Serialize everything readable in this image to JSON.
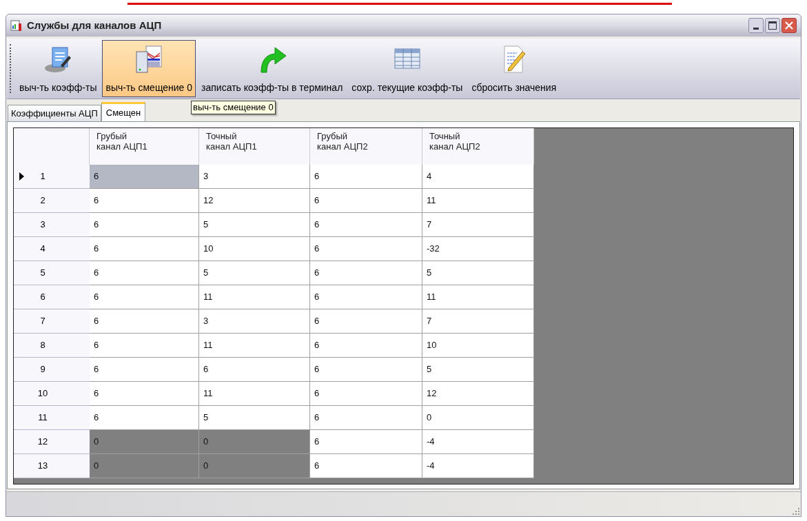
{
  "window": {
    "title": "Службы для каналов АЦП"
  },
  "toolbar": [
    {
      "label": "выч-ть коэфф-ты",
      "kind": "calc",
      "hovered": false
    },
    {
      "label": "выч-ть смещение 0",
      "kind": "offset",
      "hovered": true
    },
    {
      "label": "записать коэфф-ты в терминал",
      "kind": "write",
      "hovered": false
    },
    {
      "label": "сохр. текущие коэфф-ты",
      "kind": "save",
      "hovered": false
    },
    {
      "label": "сбросить значения",
      "kind": "reset",
      "hovered": false
    }
  ],
  "tooltip": "выч-ть смещение 0",
  "tabs": [
    {
      "label": "Коэффициенты АЦП",
      "selected": false
    },
    {
      "label": "Смещен",
      "selected": true
    }
  ],
  "table": {
    "columns": [
      "Грубый\nканал АЦП1",
      "Точный\nканал АЦП1",
      "Грубый\nканал АЦП2",
      "Точный\nканал АЦП2"
    ],
    "rows": [
      {
        "number": "1",
        "current": true,
        "cells": [
          {
            "value": "6",
            "selected": true,
            "disabled": false
          },
          {
            "value": "3",
            "selected": false,
            "disabled": false
          },
          {
            "value": "6",
            "selected": false,
            "disabled": false
          },
          {
            "value": "4",
            "selected": false,
            "disabled": false
          }
        ]
      },
      {
        "number": "2",
        "current": false,
        "cells": [
          {
            "value": "6",
            "selected": false,
            "disabled": false
          },
          {
            "value": "12",
            "selected": false,
            "disabled": false
          },
          {
            "value": "6",
            "selected": false,
            "disabled": false
          },
          {
            "value": "11",
            "selected": false,
            "disabled": false
          }
        ]
      },
      {
        "number": "3",
        "current": false,
        "cells": [
          {
            "value": "6",
            "selected": false,
            "disabled": false
          },
          {
            "value": "5",
            "selected": false,
            "disabled": false
          },
          {
            "value": "6",
            "selected": false,
            "disabled": false
          },
          {
            "value": "7",
            "selected": false,
            "disabled": false
          }
        ]
      },
      {
        "number": "4",
        "current": false,
        "cells": [
          {
            "value": "6",
            "selected": false,
            "disabled": false
          },
          {
            "value": "10",
            "selected": false,
            "disabled": false
          },
          {
            "value": "6",
            "selected": false,
            "disabled": false
          },
          {
            "value": "-32",
            "selected": false,
            "disabled": false
          }
        ]
      },
      {
        "number": "5",
        "current": false,
        "cells": [
          {
            "value": "6",
            "selected": false,
            "disabled": false
          },
          {
            "value": "5",
            "selected": false,
            "disabled": false
          },
          {
            "value": "6",
            "selected": false,
            "disabled": false
          },
          {
            "value": "5",
            "selected": false,
            "disabled": false
          }
        ]
      },
      {
        "number": "6",
        "current": false,
        "cells": [
          {
            "value": "6",
            "selected": false,
            "disabled": false
          },
          {
            "value": "11",
            "selected": false,
            "disabled": false
          },
          {
            "value": "6",
            "selected": false,
            "disabled": false
          },
          {
            "value": "11",
            "selected": false,
            "disabled": false
          }
        ]
      },
      {
        "number": "7",
        "current": false,
        "cells": [
          {
            "value": "6",
            "selected": false,
            "disabled": false
          },
          {
            "value": "3",
            "selected": false,
            "disabled": false
          },
          {
            "value": "6",
            "selected": false,
            "disabled": false
          },
          {
            "value": "7",
            "selected": false,
            "disabled": false
          }
        ]
      },
      {
        "number": "8",
        "current": false,
        "cells": [
          {
            "value": "6",
            "selected": false,
            "disabled": false
          },
          {
            "value": "11",
            "selected": false,
            "disabled": false
          },
          {
            "value": "6",
            "selected": false,
            "disabled": false
          },
          {
            "value": "10",
            "selected": false,
            "disabled": false
          }
        ]
      },
      {
        "number": "9",
        "current": false,
        "cells": [
          {
            "value": "6",
            "selected": false,
            "disabled": false
          },
          {
            "value": "6",
            "selected": false,
            "disabled": false
          },
          {
            "value": "6",
            "selected": false,
            "disabled": false
          },
          {
            "value": "5",
            "selected": false,
            "disabled": false
          }
        ]
      },
      {
        "number": "10",
        "current": false,
        "cells": [
          {
            "value": "6",
            "selected": false,
            "disabled": false
          },
          {
            "value": "11",
            "selected": false,
            "disabled": false
          },
          {
            "value": "6",
            "selected": false,
            "disabled": false
          },
          {
            "value": "12",
            "selected": false,
            "disabled": false
          }
        ]
      },
      {
        "number": "11",
        "current": false,
        "cells": [
          {
            "value": "6",
            "selected": false,
            "disabled": false
          },
          {
            "value": "5",
            "selected": false,
            "disabled": false
          },
          {
            "value": "6",
            "selected": false,
            "disabled": false
          },
          {
            "value": "0",
            "selected": false,
            "disabled": false
          }
        ]
      },
      {
        "number": "12",
        "current": false,
        "cells": [
          {
            "value": "0",
            "selected": false,
            "disabled": true
          },
          {
            "value": "0",
            "selected": false,
            "disabled": true
          },
          {
            "value": "6",
            "selected": false,
            "disabled": false
          },
          {
            "value": "-4",
            "selected": false,
            "disabled": false
          }
        ]
      },
      {
        "number": "13",
        "current": false,
        "cells": [
          {
            "value": "0",
            "selected": false,
            "disabled": true
          },
          {
            "value": "0",
            "selected": false,
            "disabled": true
          },
          {
            "value": "6",
            "selected": false,
            "disabled": false
          },
          {
            "value": "-4",
            "selected": false,
            "disabled": false
          }
        ]
      }
    ]
  }
}
